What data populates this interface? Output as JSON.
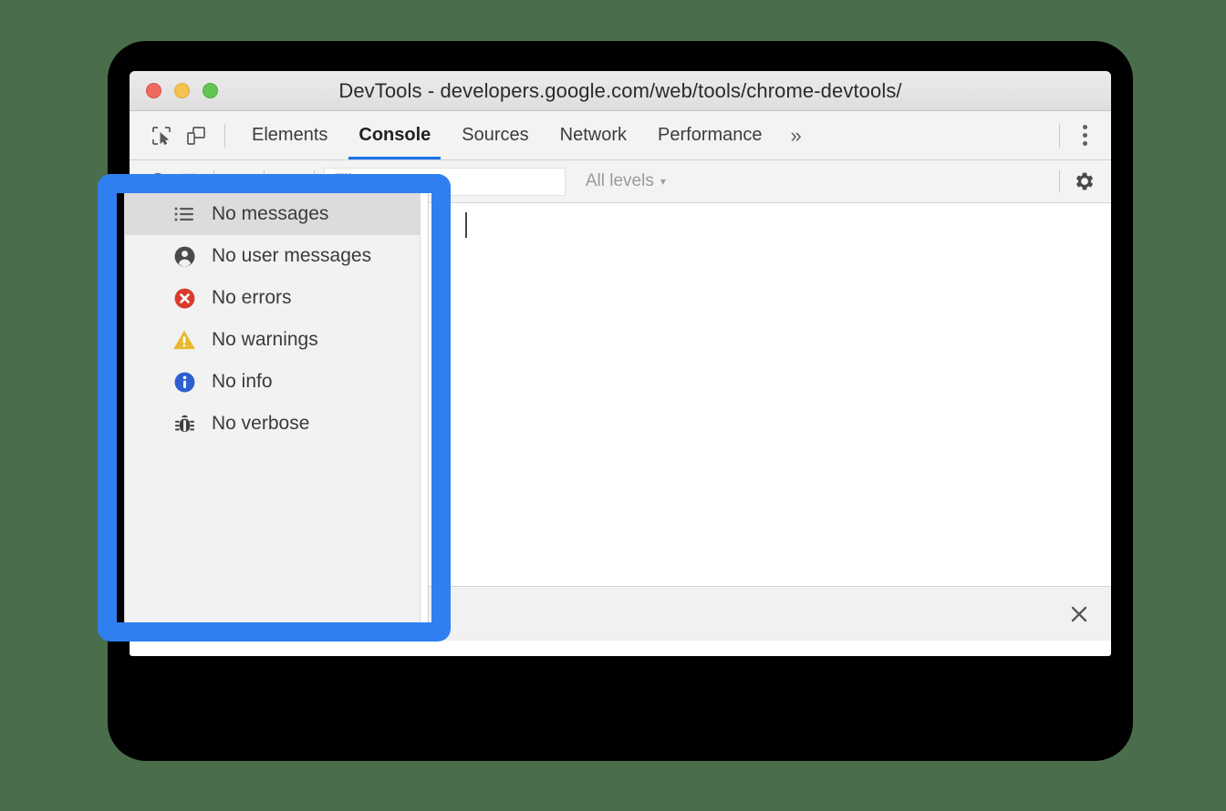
{
  "window": {
    "title": "DevTools - developers.google.com/web/tools/chrome-devtools/",
    "traffic_lights": [
      "close",
      "minimize",
      "zoom"
    ]
  },
  "tabbar": {
    "inspect_icon": "inspect-element-icon",
    "device_icon": "device-toolbar-icon",
    "tabs": [
      {
        "label": "Elements",
        "active": false
      },
      {
        "label": "Console",
        "active": true
      },
      {
        "label": "Sources",
        "active": false
      },
      {
        "label": "Network",
        "active": false
      },
      {
        "label": "Performance",
        "active": false
      }
    ],
    "overflow_label": "»",
    "more_icon": "more-vertical-icon"
  },
  "console_toolbar": {
    "caret_label": "▼",
    "eye_icon": "eye-icon",
    "filter": {
      "placeholder": "Filter",
      "value": ""
    },
    "levels": {
      "label": "All levels",
      "arrow": "▾"
    },
    "settings_icon": "gear-icon"
  },
  "console_body": {
    "prompt_caret": "|"
  },
  "drawer": {
    "close_label": "✕"
  },
  "menu": {
    "items": [
      {
        "label": "No messages",
        "icon": "list-icon",
        "selected": true
      },
      {
        "label": "No user messages",
        "icon": "person-icon",
        "selected": false
      },
      {
        "label": "No errors",
        "icon": "error-icon",
        "selected": false
      },
      {
        "label": "No warnings",
        "icon": "warning-icon",
        "selected": false
      },
      {
        "label": "No info",
        "icon": "info-icon",
        "selected": false
      },
      {
        "label": "No verbose",
        "icon": "bug-icon",
        "selected": false
      }
    ]
  },
  "colors": {
    "annotation": "#2f7ff0",
    "accent": "#1a73e8",
    "error": "#d93b2b",
    "warning": "#e8b931",
    "info": "#2d5fd0",
    "page_background": "#4a6e4c",
    "light_red": "#ec6a5e",
    "light_yellow": "#f5c14f",
    "light_green": "#62c554"
  }
}
